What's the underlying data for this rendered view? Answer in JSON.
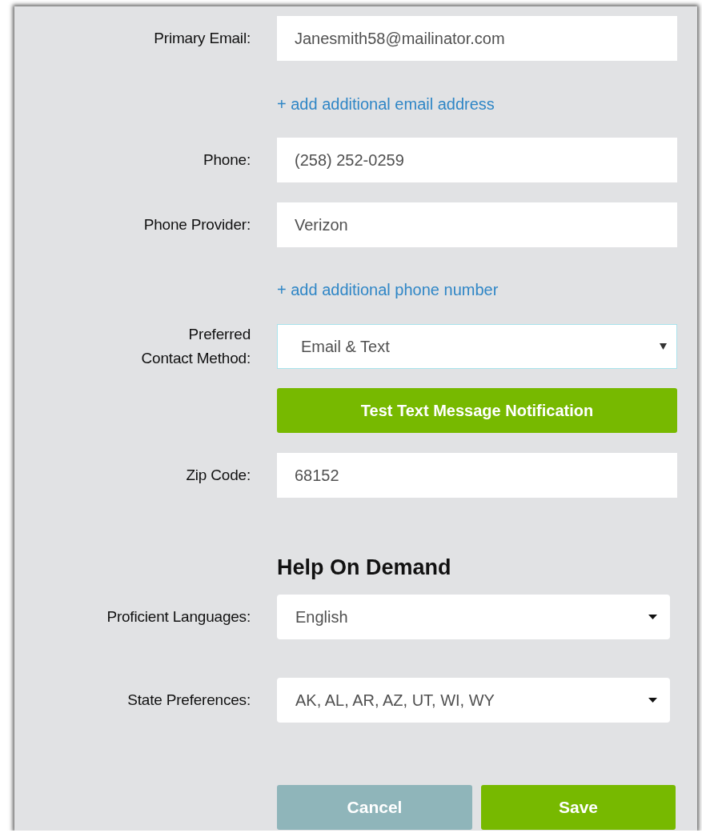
{
  "form": {
    "rows": [
      {
        "kind": "text",
        "label": "Primary Email:",
        "value": "Janesmith58@mailinator.com"
      },
      {
        "kind": "link",
        "text": "+ add additional email address"
      },
      {
        "kind": "text",
        "label": "Phone:",
        "value": "(258) 252-0259"
      },
      {
        "kind": "text",
        "label": "Phone Provider:",
        "value": "Verizon"
      },
      {
        "kind": "link",
        "text": "+ add additional phone number"
      },
      {
        "kind": "select",
        "label": "Preferred\nContact Method:",
        "value": "Email & Text"
      },
      {
        "kind": "button",
        "text": "Test Text Message Notification"
      },
      {
        "kind": "text",
        "label": "Zip Code:",
        "value": "68152"
      },
      {
        "kind": "heading",
        "text": "Help On Demand"
      },
      {
        "kind": "dropdown",
        "label": "Proficient Languages:",
        "value": "English"
      },
      {
        "kind": "dropdown",
        "label": "State Preferences:",
        "value": "AK, AL, AR, AZ, UT, WI, WY"
      }
    ],
    "actions": [
      {
        "label": "Cancel",
        "disabled": true
      },
      {
        "label": "Save",
        "disabled": false
      }
    ]
  }
}
